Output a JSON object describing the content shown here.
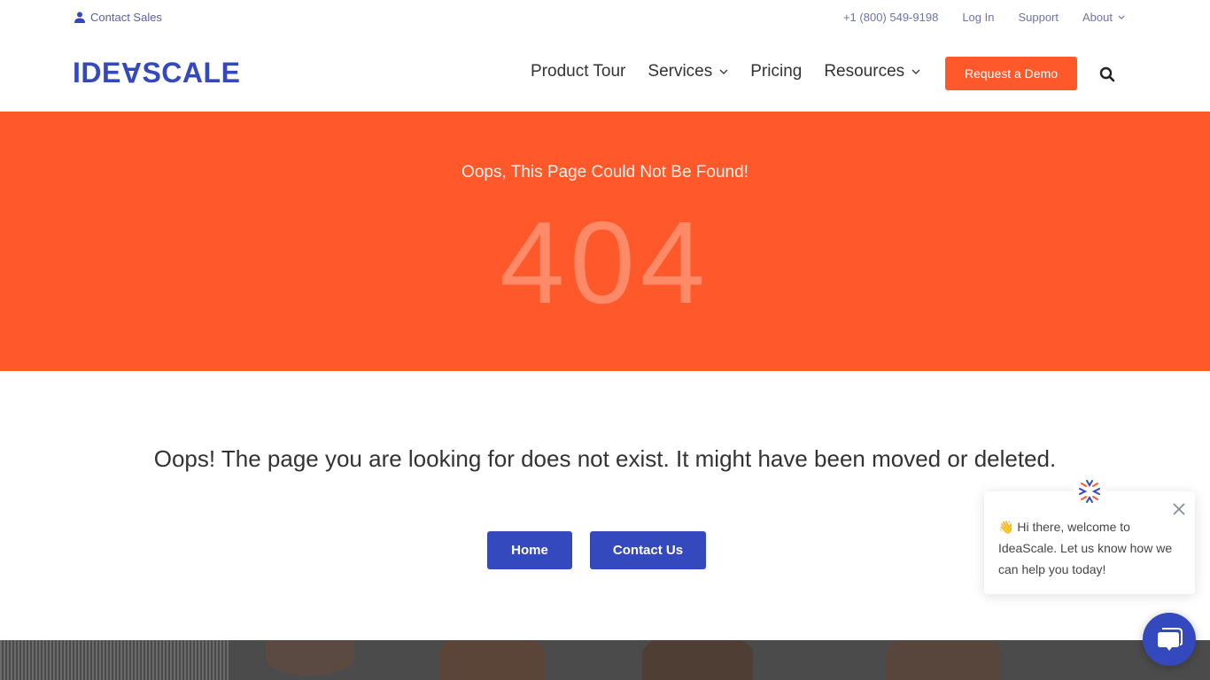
{
  "colors": {
    "brand_blue": "#3549be",
    "brand_orange": "#ff582b",
    "number_tint": "#ff8a68"
  },
  "topbar": {
    "contact_sales": "Contact Sales",
    "contact_icon": "user-icon",
    "phone": "+1 (800) 549-9198",
    "login": "Log In",
    "support": "Support",
    "about": "About"
  },
  "header": {
    "logo_prefix": "IDE",
    "logo_flipped": "A",
    "logo_suffix": "SCALE",
    "nav": [
      {
        "label": "Product Tour",
        "dropdown": false
      },
      {
        "label": "Services",
        "dropdown": true
      },
      {
        "label": "Pricing",
        "dropdown": false
      },
      {
        "label": "Resources",
        "dropdown": true
      }
    ],
    "cta": "Request a Demo",
    "search_icon": "search-icon"
  },
  "hero": {
    "subtitle": "Oops, This Page Could Not Be Found!",
    "code": "404"
  },
  "main": {
    "message": "Oops! The page you are looking for does not exist. It might have been moved or deleted.",
    "home_button": "Home",
    "contact_button": "Contact Us"
  },
  "chat": {
    "emoji": "👋",
    "greeting": "Hi there, welcome to IdeaScale. Let us know how we can help you today!",
    "close_icon": "close-icon",
    "launcher_icon": "chat-bubble-icon"
  }
}
